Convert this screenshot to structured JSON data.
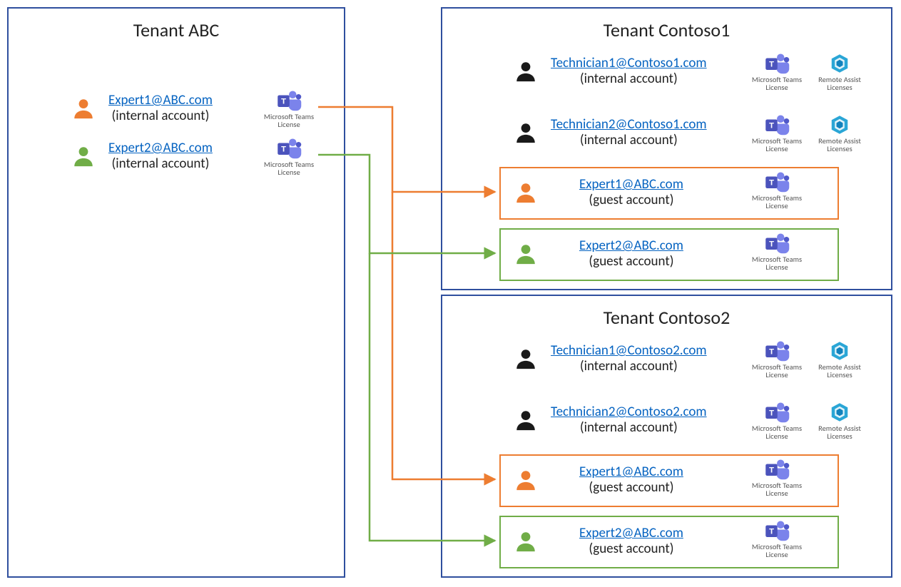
{
  "colors": {
    "orange": "#ed7d31",
    "green": "#70ad47",
    "black": "#1a1a1a",
    "blueBorder": "#2f4f9e",
    "link": "#0563c1"
  },
  "licenseCaptions": {
    "teams": "Microsoft Teams License",
    "remoteAssist": "Remote Assist Licenses"
  },
  "tenants": {
    "abc": {
      "title": "Tenant ABC",
      "users": [
        {
          "email": "Expert1@ABC.com",
          "sub": "(internal account)",
          "color": "orange",
          "licenses": [
            "teams"
          ]
        },
        {
          "email": "Expert2@ABC.com",
          "sub": "(internal account)",
          "color": "green",
          "licenses": [
            "teams"
          ]
        }
      ]
    },
    "contoso1": {
      "title": "Tenant Contoso1",
      "users": [
        {
          "email": "Technician1@Contoso1.com",
          "sub": "(internal account)",
          "color": "black",
          "licenses": [
            "teams",
            "remoteAssist"
          ]
        },
        {
          "email": "Technician2@Contoso1.com",
          "sub": "(internal account)",
          "color": "black",
          "licenses": [
            "teams",
            "remoteAssist"
          ]
        },
        {
          "email": "Expert1@ABC.com",
          "sub": "(guest account)",
          "color": "orange",
          "guestBorder": "orange",
          "licenses": [
            "teams"
          ]
        },
        {
          "email": "Expert2@ABC.com",
          "sub": "(guest account)",
          "color": "green",
          "guestBorder": "green",
          "licenses": [
            "teams"
          ]
        }
      ]
    },
    "contoso2": {
      "title": "Tenant Contoso2",
      "users": [
        {
          "email": "Technician1@Contoso2.com",
          "sub": "(internal account)",
          "color": "black",
          "licenses": [
            "teams",
            "remoteAssist"
          ]
        },
        {
          "email": "Technician2@Contoso2.com",
          "sub": "(internal account)",
          "color": "black",
          "licenses": [
            "teams",
            "remoteAssist"
          ]
        },
        {
          "email": "Expert1@ABC.com",
          "sub": "(guest account)",
          "color": "orange",
          "guestBorder": "orange",
          "licenses": [
            "teams"
          ]
        },
        {
          "email": "Expert2@ABC.com",
          "sub": "(guest account)",
          "color": "green",
          "guestBorder": "green",
          "licenses": [
            "teams"
          ]
        }
      ]
    }
  },
  "connectors": [
    {
      "from": "abc.user0",
      "to": "contoso1.guest0",
      "color": "orange"
    },
    {
      "from": "abc.user1",
      "to": "contoso1.guest1",
      "color": "green"
    },
    {
      "from": "abc.user0",
      "to": "contoso2.guest0",
      "color": "orange"
    },
    {
      "from": "abc.user1",
      "to": "contoso2.guest1",
      "color": "green"
    }
  ]
}
